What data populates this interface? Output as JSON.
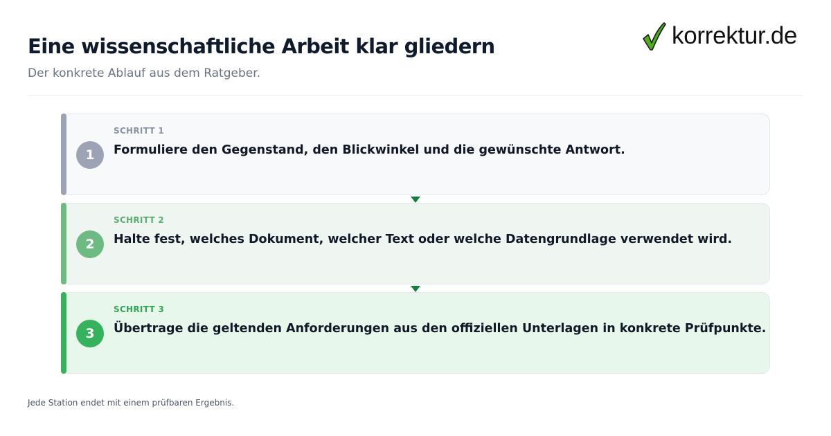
{
  "header": {
    "title": "Eine wissenschaftliche Arbeit klar gliedern",
    "subtitle": "Der konkrete Ablauf aus dem Ratgeber."
  },
  "logo": {
    "text": "korrektur.de",
    "icon": "checkmark-icon",
    "check_color": "#4caf1a"
  },
  "steps": [
    {
      "label": "SCHRITT 1",
      "number": "1",
      "text": "Formuliere den Gegenstand, den Blickwinkel und die gewünschte Antwort.",
      "bar_color": "#9ca3b4",
      "label_color": "#8b93a3",
      "background": "#f8f9fb"
    },
    {
      "label": "SCHRITT 2",
      "number": "2",
      "text": "Halte fest, welches Dokument, welcher Text oder welche Datengrundlage verwendet wird.",
      "bar_color": "#6dba82",
      "label_color": "#5aae72",
      "background": "#eff6f1"
    },
    {
      "label": "SCHRITT 3",
      "number": "3",
      "text": "Übertrage die geltenden Anforderungen aus den offiziellen Unterlagen in konkrete Prüfpunkte.",
      "bar_color": "#35b25b",
      "label_color": "#2ea752",
      "background": "#e8f7eb"
    }
  ],
  "connector_color": "#15803d",
  "footer": {
    "note": "Jede Station endet mit einem prüfbaren Ergebnis."
  }
}
